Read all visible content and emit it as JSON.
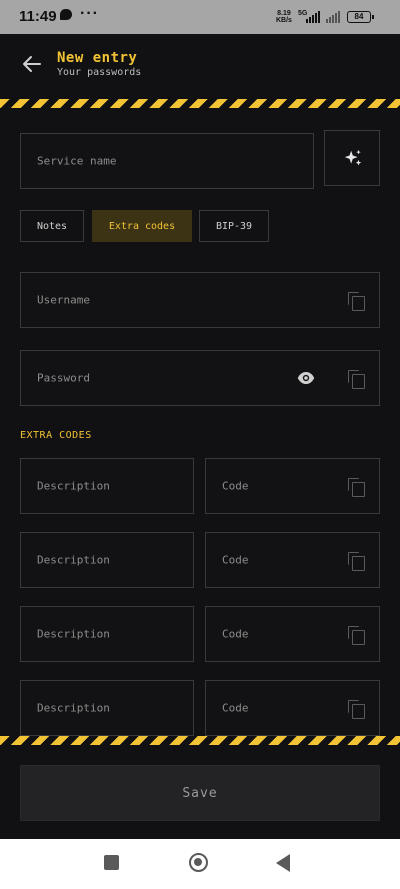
{
  "status_bar": {
    "time": "11:49",
    "speed_value": "8.19",
    "speed_unit": "KB/s",
    "network": "5G",
    "battery": "84"
  },
  "header": {
    "title": "New entry",
    "subtitle": "Your passwords"
  },
  "form": {
    "service_placeholder": "Service name",
    "tabs": [
      {
        "label": "Notes",
        "active": false
      },
      {
        "label": "Extra codes",
        "active": true
      },
      {
        "label": "BIP-39",
        "active": false
      }
    ],
    "username_placeholder": "Username",
    "password_placeholder": "Password",
    "extra_codes_heading": "EXTRA CODES",
    "extra_codes": [
      {
        "description_placeholder": "Description",
        "code_placeholder": "Code"
      },
      {
        "description_placeholder": "Description",
        "code_placeholder": "Code"
      },
      {
        "description_placeholder": "Description",
        "code_placeholder": "Code"
      },
      {
        "description_placeholder": "Description",
        "code_placeholder": "Code"
      }
    ]
  },
  "actions": {
    "save_label": "Save"
  },
  "colors": {
    "accent": "#f2c335",
    "background": "#111113",
    "tab_active_bg": "#3c3214"
  },
  "icons": [
    "back-arrow-icon",
    "sparkle-icon",
    "copy-icon",
    "eye-icon"
  ]
}
